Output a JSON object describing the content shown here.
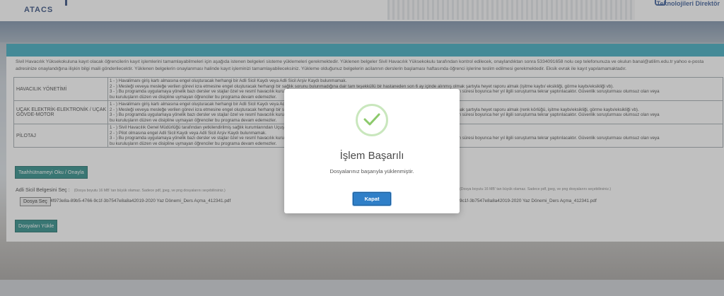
{
  "header": {
    "logo_text": "ATACS",
    "partner_text": "Teknolojileri Direktör"
  },
  "intro_text": "Sivil Havacılık Yüksekokuluna kayıt olacak öğrencilerin kayıt işlemlerini tamamlayabilmeleri için aşağıda istenen belgeleri sisteme yüklemeleri gerekmektedir. Yüklenen belgeler Sivil Havacılık Yüksekokulu tarafından kontrol edilecek, onaylandıktan sonra 5334091658 nolu cep telefonunuza ve okulun banal@atilim.edu.tr yahoo e-posta adresinize onaylandığına ilişkin bilgi maili gönderilecektir. Yüklenen belgelerin onaylanması halinde kayıt işleminizi tamamlayabileceksiniz. Yükleme olduğunuz belgelerin acilannın derslerin başlaması haftasında öğrenci işlerine teslim edilmesi gerekmektedir. Eksik evrak ile kayıt yapılamamaktadır.",
  "requirements": [
    {
      "program": "HAVACILIK YÖNETİMİ",
      "items": [
        "1 - ) Havalimanı giriş kartı almasına engel oluşturacak herhangi bir Adli Sicil Kaydı veya Adli Sicil Arşiv Kaydı bulunmamak.",
        "2 - ) Mesleği veveya mesleğe verilen görevi icra etmesine engel oluşturacak herhangi bir sağlık sorunu bulunmadığına dair tam teşekküllü bir hastaneden son 6 ay içinde alınmış olmak şartıyla heyet raporu almak (işitme kaybı/ eksikliği, görme kaybı/eksikliği vb).",
        "3 - ) Bu programda uygulamaya yönelik bazı dersler ve stajlar özel ve resmî havacılık kuruluşlarında yapılacaktır. Bu kuruluşlar tarafından güvenlik soruşturması yaptırılacaktır. Eğitim süresi boyunca her yıl ilgili soruşturma tekrar yaptırılacaktır. Güvenlik soruşturması olumsuz olan veya",
        "bu kuruluşların düzen ve disipline uymayan öğrenciler bu programa devam edemezler."
      ]
    },
    {
      "program": "UÇAK ELEKTRİK-ELEKTRONİK / UÇAK GÖVDE-MOTOR",
      "items": [
        "1 - ) Havalimanı giriş kartı almasına engel oluşturacak herhangi bir Adli Sicil Kaydı veya Adli Sicil Arşiv Kaydı bulunmamak.",
        "2 - ) Mesleği veveya mesleğe verilen görevi icra etmesine engel oluşturacak herhangi bir sağlık sorunu bulunmadığına dair tam teşekküllü bir hastaneden son 6 ay içinde alınmış olmak şartıyla heyet raporu almak (renk körlüğü, işitme kaybı/eksikliği, görme kaybı/eksikliği vb).",
        "3 - ) Bu programda uygulamaya yönelik bazı dersler ve stajlar özel ve resmî havacılık kuruluşlarında yapılacaktır. Bu kuruluşlar tarafından güvenlik soruşturması yaptırılacaktır. Eğitim süresi boyunca her yıl ilgili soruşturma tekrar yaptırılacaktır. Güvenlik soruşturması olumsuz olan veya",
        "bu kuruluşların düzen ve disipline uymayan öğrenciler bu programa devam edemezler."
      ]
    },
    {
      "program": "PİLOTAJ",
      "items": [
        "1 - ) Sivil Havacılık Genel Müdürlüğü tarafından yetkilendirilmiş sağlık kurumlarından Uçuş Personeli Sağlık Yönetmeliğinde belirtilen Sınıf 1 hükümlerine uygun sağlık raporu almak.",
        "2 - ) Pilot olmasına engel Adli Sicil Kaydı veya Adli Sicil Arşiv Kaydı bulunmamak.",
        "3 - ) Bu programda uygulamaya yönelik bazı dersler ve stajlar özel ve resmî havacılık kuruluşlarında yapılacaktır. Bu kuruluşlar tarafından güvenlik soruşturması yaptırılacaktır. Eğitim süresi boyunca her yıl ilgili soruşturma tekrar yaptırılacaktır. Güvenlik soruşturması olumsuz olan veya",
        "bu kuruluşların düzen ve disipline uymayan öğrenciler bu programa devam edemezler."
      ]
    }
  ],
  "pledge_button": "Taahhütnameyi Oku / Onayla",
  "upload": {
    "label": "Adli Sicil Belgesini Seç :",
    "hint": "(Dosya boyutu 16 MB' tan büyük olamaz. Sadece pdf, jpeg, ve png dosyalarını seçebilirsiniz.)",
    "hint_right": "(Dosya boyutu 16 MB' tan büyük olamaz. Sadece pdf, jpeg, ve png dosyalarını seçebilirsiniz.)",
    "choose_button": "Dosya Seç",
    "file_name": "4f973e8a-89b5-4766-9c1f-3b7547e8a8a42019-2020 Yaz Dönemi_Ders Açma_412341.pdf",
    "file_name_right": "9c1f-3b7547e8a8a42019-2020 Yaz Dönemi_Ders Açma_412341.pdf",
    "submit_button": "Dosyaları Yükle"
  },
  "modal": {
    "title": "İşlem Başarılı",
    "message": "Dosyalarınız başarıyla yüklenmiştir.",
    "close_button": "Kapat",
    "icon": "success-check-icon",
    "ring_color": "#c9e7bd",
    "check_color": "#8cc96b",
    "button_color": "#2f7fc8"
  },
  "colors": {
    "panel_header": "#2aa3b8",
    "teal_button": "#17807a"
  }
}
